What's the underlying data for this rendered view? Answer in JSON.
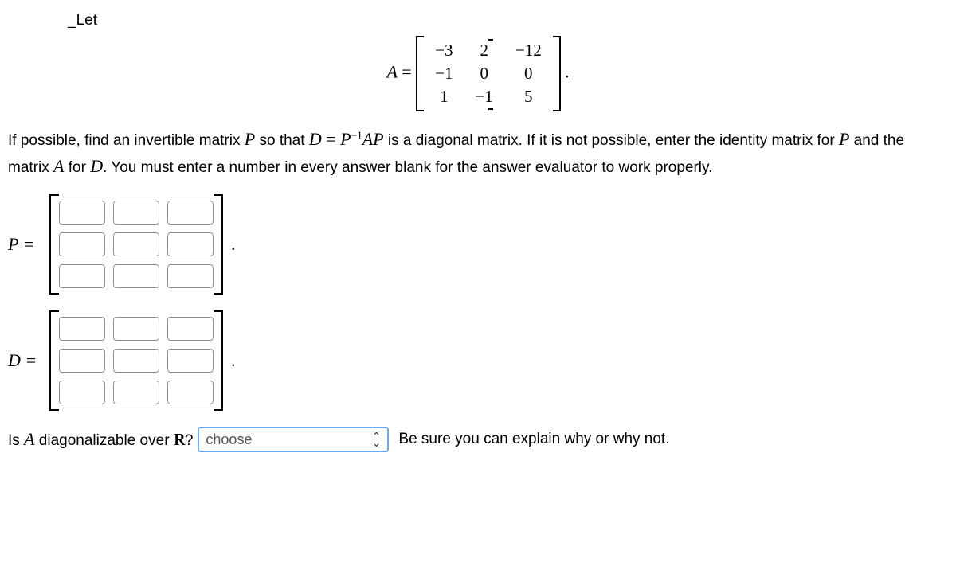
{
  "let_text": "Let",
  "matrix_A": {
    "label": "A",
    "rows": [
      [
        "−3",
        "2",
        "−12"
      ],
      [
        "−1",
        "0",
        "0"
      ],
      [
        "1",
        "−1",
        "5"
      ]
    ]
  },
  "instructions": {
    "part1": "If possible, find an invertible matrix ",
    "P": "P",
    "part2": " so that ",
    "D": "D",
    "eq": " = ",
    "Pinv": "P",
    "inv_exp": "−1",
    "AP": "AP",
    "part3": " is a diagonal matrix. If it is not possible, enter the identity matrix for ",
    "part4": " and the matrix ",
    "A2": "A",
    "part5": " for ",
    "D2": "D",
    "part6": ". You must enter a number in every answer blank for the answer evaluator to work properly."
  },
  "P_label": "P =",
  "D_label": "D =",
  "final_question": {
    "part1": "Is ",
    "A": "A",
    "part2": " diagonalizable over ",
    "R": "R",
    "q": "?",
    "note": "Be sure you can explain why or why not."
  },
  "select_placeholder": "choose"
}
